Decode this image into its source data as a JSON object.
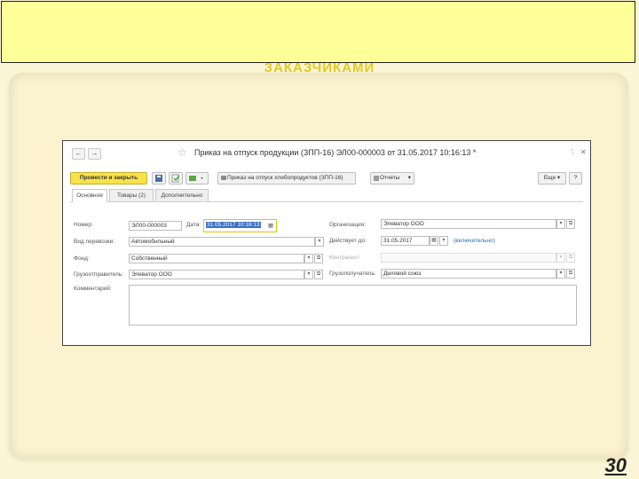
{
  "slide": {
    "title_shadow": "ЗАКАЗЧИКАМИ",
    "page_number": "30"
  },
  "window": {
    "title": "Приказ на отпуск продукции (ЗПП-16) ЭЛ00-000003 от 31.05.2017 10:16:13 *",
    "nav_back": "←",
    "nav_forward": "→",
    "star": "☆",
    "more_icon": "⋮",
    "close_icon": "✕"
  },
  "toolbar": {
    "post_close_label": "Провести и закрыть",
    "print_label": "Приказ на отпуск хлебопродуктов (ЗПП-16)",
    "reports_label": "Отчеты",
    "more_label": "Еще",
    "help_label": "?"
  },
  "tabs": [
    {
      "label": "Основное"
    },
    {
      "label": "Товары (2)"
    },
    {
      "label": "Дополнительно"
    }
  ],
  "form": {
    "number_label": "Номер:",
    "number_value": "ЭЛ00-000003",
    "date_label": "Дата:",
    "date_value": "31.05.2017 10:16:13",
    "org_label": "Организация:",
    "org_value": "Элеватор ООО",
    "transport_label": "Вид перевозки:",
    "transport_value": "Автомобильный",
    "valid_label": "Действует до:",
    "valid_value": "31.05.2017",
    "inclusive": "(включительно)",
    "fund_label": "Фонд:",
    "fund_value": "Собственный",
    "contractor_label": "Контрагент:",
    "contractor_value": "",
    "shipper_label": "Грузоотправитель:",
    "shipper_value": "Элеватор ООО",
    "consignee_label": "Грузополучатель:",
    "consignee_value": "Деловой союз",
    "comment_label": "Комментарий:",
    "comment_value": ""
  },
  "icons": {
    "dropdown": "▾",
    "open": "⧉",
    "calendar": "▦"
  }
}
